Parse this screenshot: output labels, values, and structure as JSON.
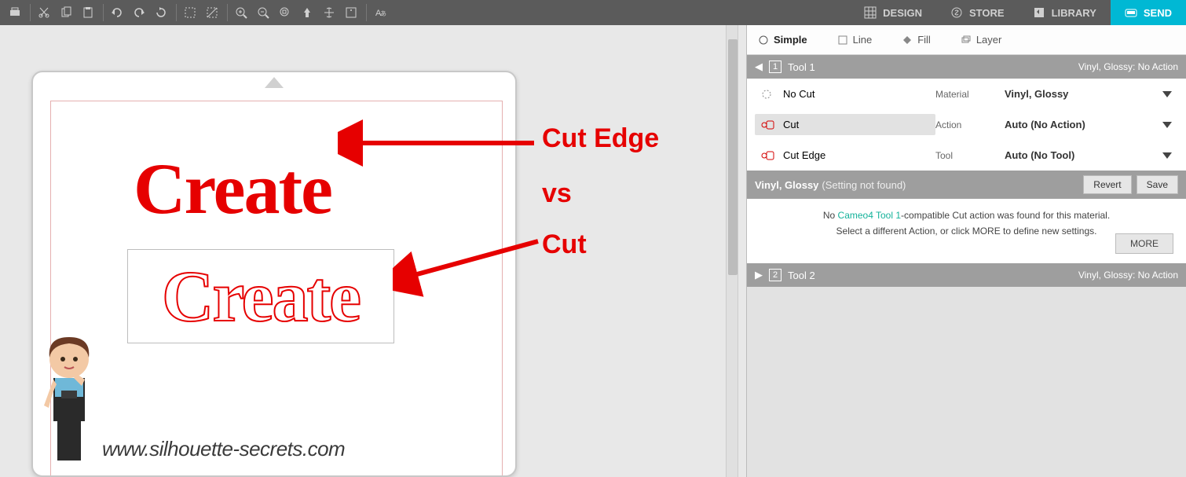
{
  "main_tabs": {
    "design": "DESIGN",
    "store": "STORE",
    "library": "LIBRARY",
    "send": "SEND"
  },
  "sub_tabs": {
    "simple": "Simple",
    "line": "Line",
    "fill": "Fill",
    "layer": "Layer"
  },
  "tool1": {
    "label": "Tool 1",
    "status": "Vinyl, Glossy: No Action",
    "options": {
      "no_cut": "No Cut",
      "cut": "Cut",
      "cut_edge": "Cut Edge"
    },
    "props": {
      "material_label": "Material",
      "material_value": "Vinyl, Glossy",
      "action_label": "Action",
      "action_value": "Auto (No Action)",
      "tool_label": "Tool",
      "tool_value": "Auto (No Tool)"
    }
  },
  "settings_bar": {
    "name": "Vinyl, Glossy",
    "note": "(Setting not found)",
    "revert": "Revert",
    "save": "Save"
  },
  "message": {
    "prefix": "No ",
    "link": "Cameo4 Tool 1",
    "line1_suffix": "-compatible Cut action was found for this material.",
    "line2": "Select a different Action, or click MORE to define new settings.",
    "more": "MORE"
  },
  "tool2": {
    "label": "Tool 2",
    "status": "Vinyl, Glossy: No Action"
  },
  "canvas": {
    "word": "Create"
  },
  "annotations": {
    "cut_edge": "Cut Edge",
    "vs": "vs",
    "cut": "Cut"
  },
  "watermark": "www.silhouette-secrets.com"
}
